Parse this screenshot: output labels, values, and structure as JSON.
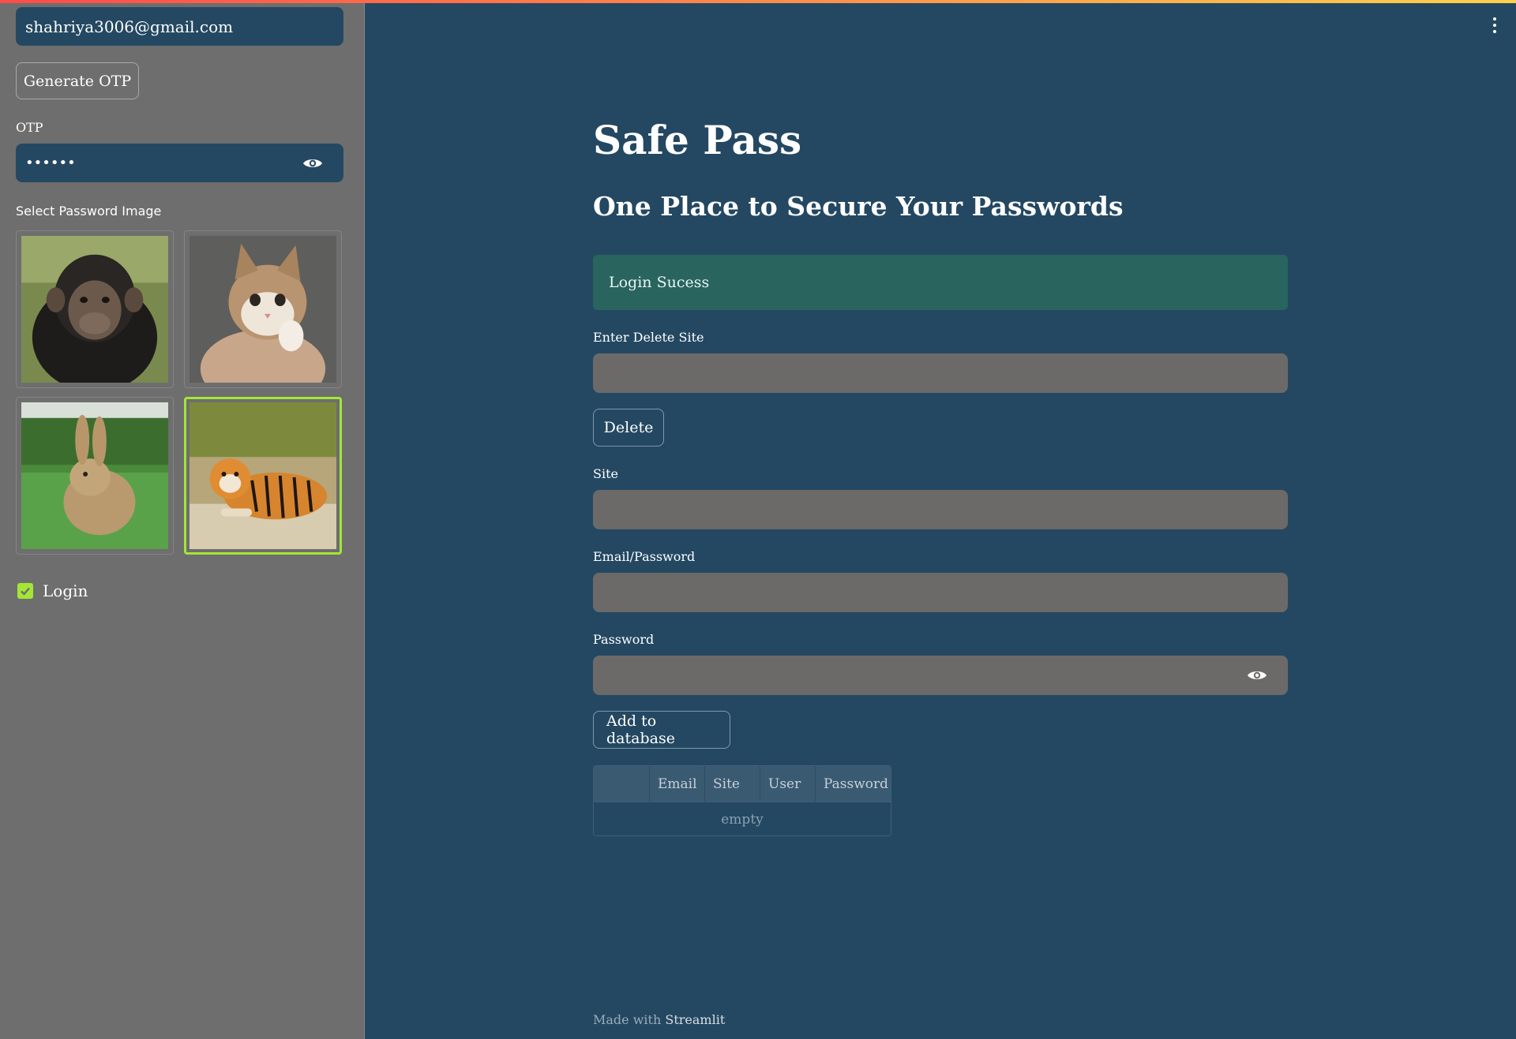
{
  "sidebar": {
    "email_value": "shahriya3006@gmail.com",
    "generate_otp_label": "Generate OTP",
    "otp_label": "OTP",
    "otp_value": "••••••",
    "select_image_label": "Select Password Image",
    "images": [
      {
        "name": "chimpanzee",
        "selected": false
      },
      {
        "name": "kitten",
        "selected": false
      },
      {
        "name": "rabbit",
        "selected": false
      },
      {
        "name": "tiger",
        "selected": true
      }
    ],
    "login_label": "Login",
    "login_checked": true
  },
  "main": {
    "title": "Safe Pass",
    "subtitle": "One Place to Secure Your Passwords",
    "alert_text": "Login Sucess",
    "delete_site_label": "Enter Delete Site",
    "delete_button": "Delete",
    "site_label": "Site",
    "email_password_label": "Email/Password",
    "password_label": "Password",
    "add_button": "Add to database",
    "table": {
      "columns": [
        "Email",
        "Site",
        "User",
        "Password"
      ],
      "empty_text": "empty"
    },
    "footer_prefix": "Made with",
    "footer_brand": "Streamlit"
  },
  "colors": {
    "background": "#244862",
    "sidebar": "#6e6e6e",
    "input_field": "#6b6a68",
    "alert": "#29645f",
    "selected_border": "#a3e635"
  }
}
